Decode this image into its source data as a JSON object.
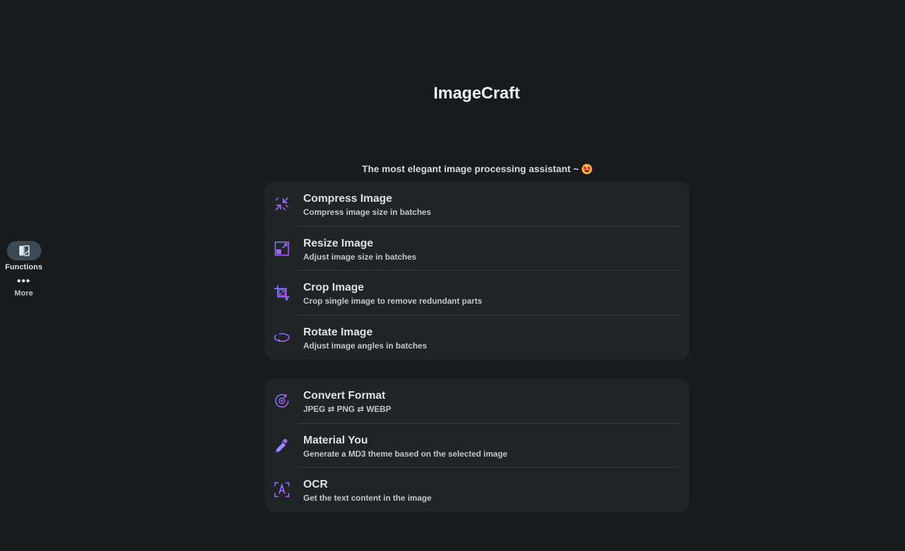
{
  "app": {
    "title": "ImageCraft",
    "subtitle": "The most elegant image processing assistant ~"
  },
  "rail": {
    "functions_label": "Functions",
    "more_label": "More",
    "more_glyph": "•••"
  },
  "groups": [
    {
      "items": [
        {
          "title": "Compress Image",
          "desc": "Compress image size in batches",
          "icon": "compress-icon"
        },
        {
          "title": "Resize Image",
          "desc": "Adjust image size in batches",
          "icon": "resize-icon"
        },
        {
          "title": "Crop Image",
          "desc": "Crop single image to remove redundant parts",
          "icon": "crop-icon"
        },
        {
          "title": "Rotate Image",
          "desc": "Adjust image angles in batches",
          "icon": "rotate-icon"
        }
      ]
    },
    {
      "items": [
        {
          "title": "Convert Format",
          "desc": "JPEG ⇄ PNG ⇄ WEBP",
          "icon": "convert-icon"
        },
        {
          "title": "Material You",
          "desc": "Generate a MD3 theme based on the selected image",
          "icon": "dropper-icon"
        },
        {
          "title": "OCR",
          "desc": "Get the text content in the image",
          "icon": "ocr-icon"
        }
      ]
    }
  ],
  "colors": {
    "background": "#181c1f",
    "card": "#1f2426",
    "icon_gradient_start": "#6f7dff",
    "icon_gradient_end": "#c84dff",
    "rail_active": "#3b4a55"
  }
}
